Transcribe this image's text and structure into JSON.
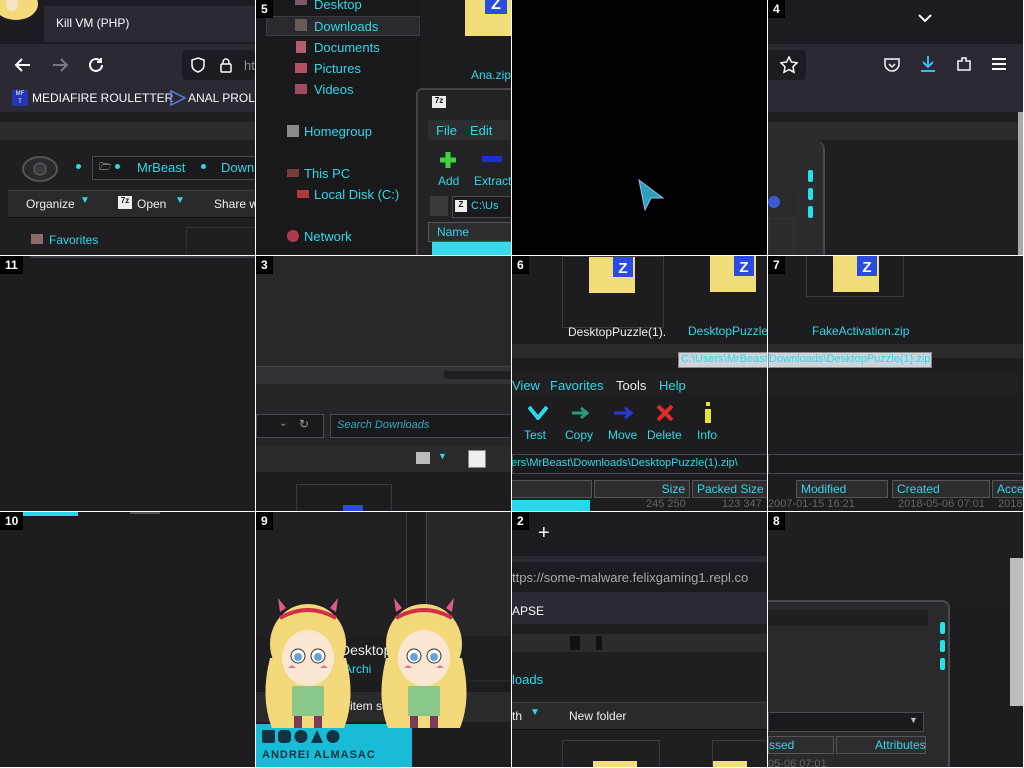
{
  "tiles": {
    "t1": {
      "number": "",
      "tab_title": "Kill VM (PHP)",
      "bookmarks": [
        "MEDIAFIRE ROULETTER",
        "ANAL PROLA"
      ],
      "url_fragment": "ht",
      "address": [
        "MrBeast",
        "Down"
      ],
      "toolbar": [
        "Organize",
        "Open",
        "Share w"
      ],
      "nav_item": "Favorites"
    },
    "t5": {
      "number": "5",
      "nav": [
        "Desktop",
        "Downloads",
        "Documents",
        "Pictures",
        "Videos",
        "Homegroup",
        "This PC",
        "Local Disk (C:)",
        "Network"
      ],
      "zip_name": "Ana.zip",
      "menu": [
        "File",
        "Edit"
      ],
      "tools": [
        "Add",
        "Extract"
      ],
      "path": "C:\\Us",
      "col": "Name"
    },
    "t_black": {
      "number": ""
    },
    "t4": {
      "number": "4"
    },
    "t11": {
      "number": "11"
    },
    "t3": {
      "number": "3",
      "search_placeholder": "Search Downloads"
    },
    "t6": {
      "number": "6",
      "file_label": "DesktopPuzzle(1).",
      "menu": [
        "View",
        "Favorites",
        "Tools",
        "Help"
      ],
      "tools": [
        "Test",
        "Copy",
        "Move",
        "Delete",
        "Info"
      ],
      "path": "ers\\MrBeast\\Downloads\\DesktopPuzzle(1).zip\\",
      "cols": [
        "Size",
        "Packed Size",
        "Modified"
      ],
      "row": {
        "size": "245 250",
        "packed": "123 347",
        "modified": "2007-01-15 16:21"
      },
      "tooltip_left": "C:\\Users\\MrBeast\\"
    },
    "t7": {
      "number": "7",
      "files": [
        "DesktopPuzzle.zip",
        "FakeActivation.zip"
      ],
      "tooltip_right": "Downloads\\DesktopPuzzle(1).zip",
      "cols": [
        "Created",
        "Acce"
      ],
      "row_created": "2018-05-06 07:01",
      "row_extra": "2018-"
    },
    "t10": {
      "number": "10"
    },
    "t9": {
      "number": "9",
      "title_frag": "Desktop",
      "subtitle_frag": "ip Archi",
      "status_frag": "item selec",
      "watermark": "ANDREI ALMASAC"
    },
    "t2": {
      "number": "2",
      "new_tab": "+",
      "url": "ttps://some-malware.felixgaming1.repl.co",
      "url_host": "felixgaming1",
      "bookmark_frag": "APSE",
      "breadcrumb_frag": "loads",
      "toolbar": [
        "th",
        "New folder"
      ]
    },
    "t8": {
      "number": "8",
      "cols": [
        "ssed",
        "Attributes"
      ],
      "row": "05-06 07:01"
    }
  },
  "colors": {
    "accent": "#2fd8e8",
    "bg": "#1d1d1f",
    "panel": "#2a2a2d"
  }
}
